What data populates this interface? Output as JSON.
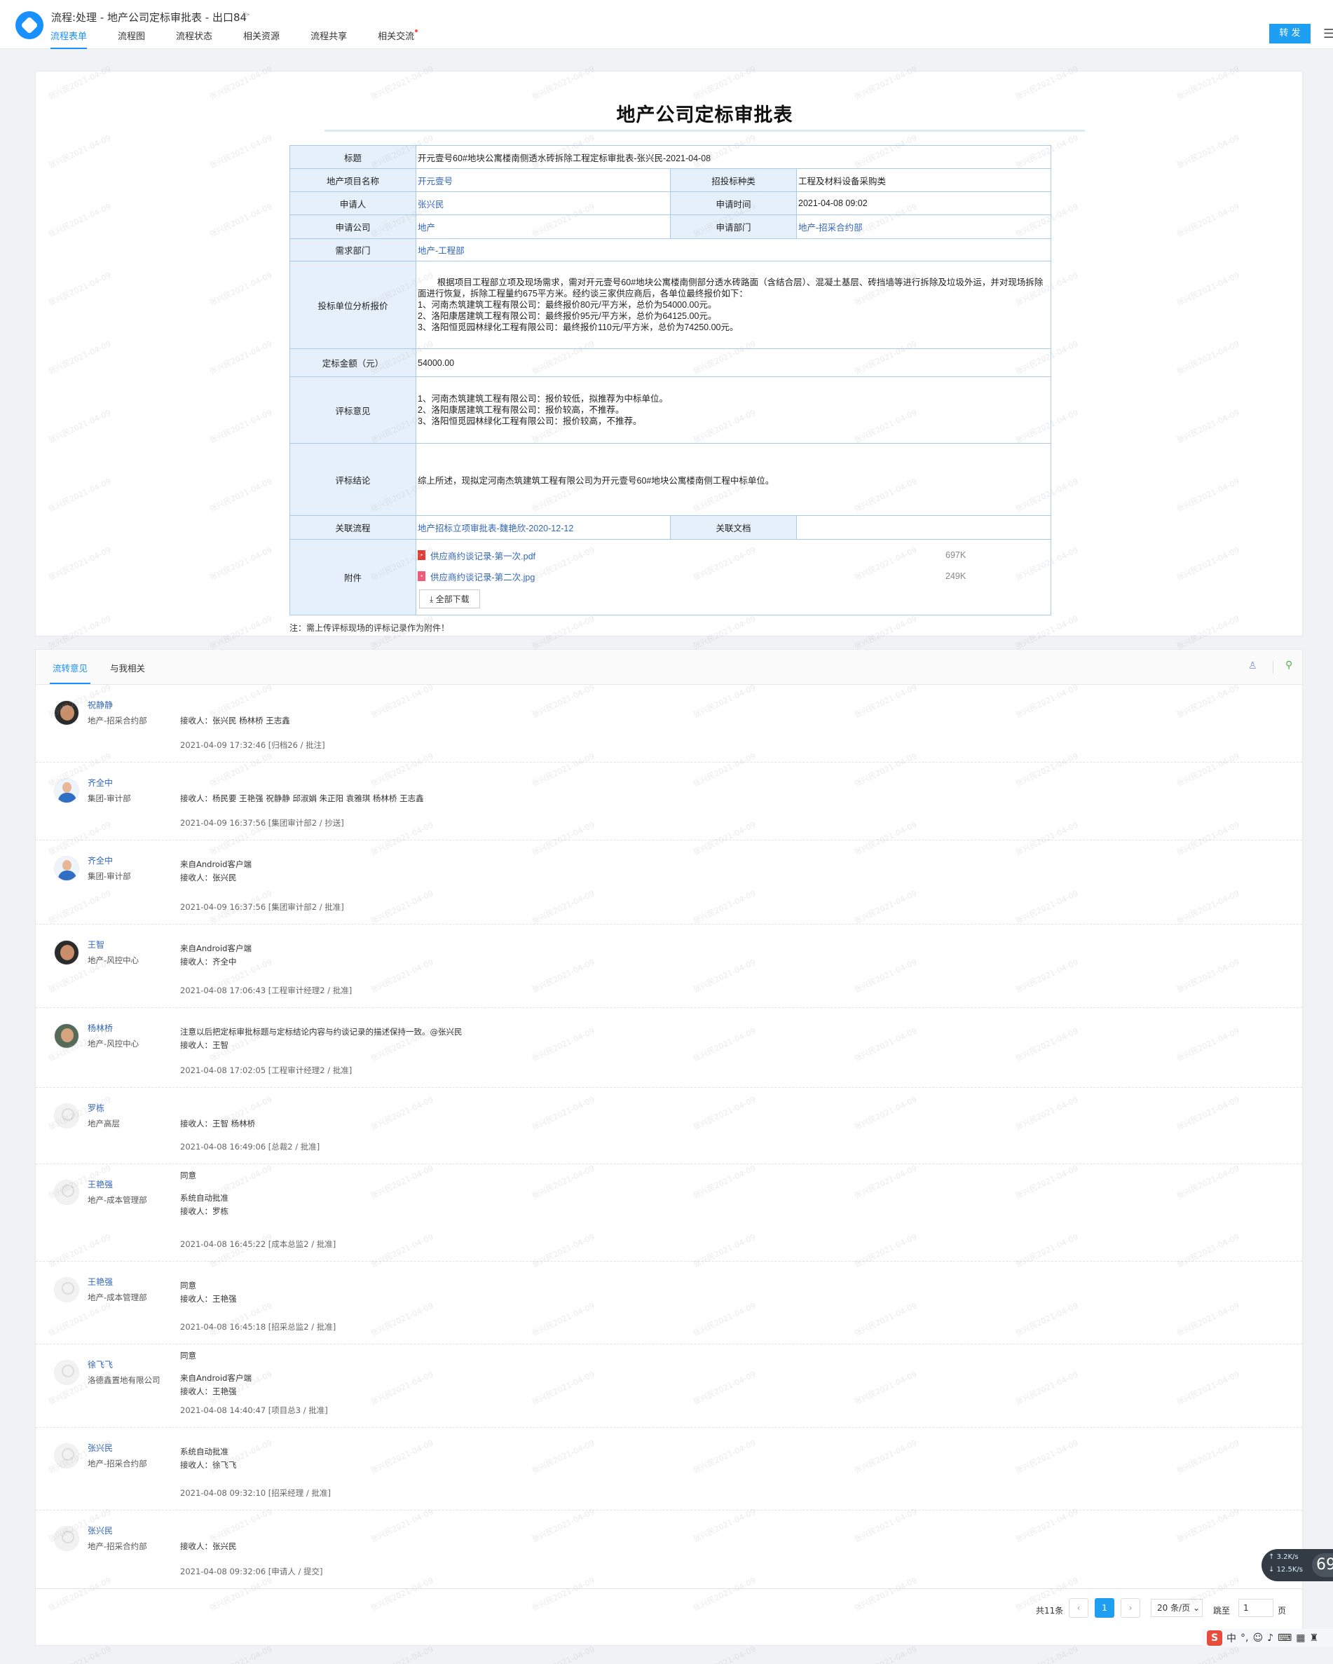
{
  "header": {
    "doc_title": "流程:处理 - 地产公司定标审批表 - 出口84",
    "tabs": [
      {
        "label": "流程表单",
        "active": true
      },
      {
        "label": "流程图"
      },
      {
        "label": "流程状态"
      },
      {
        "label": "相关资源"
      },
      {
        "label": "流程共享"
      },
      {
        "label": "相关交流",
        "badge": true
      }
    ],
    "forward_label": "转 发",
    "accent_color": "#1e9ff2"
  },
  "form": {
    "title": "地产公司定标审批表",
    "labels": {
      "title": "标题",
      "project": "地产项目名称",
      "bid_type": "招投标种类",
      "applicant": "申请人",
      "apply_time": "申请时间",
      "company": "申请公司",
      "dept": "申请部门",
      "demand_dept": "需求部门",
      "quote_analysis": "投标单位分析报价",
      "amount": "定标金额（元）",
      "opinion": "评标意见",
      "conclusion": "评标结论",
      "related_flow": "关联流程",
      "related_doc": "关联文档",
      "attachments": "附件"
    },
    "values": {
      "title": "开元壹号60#地块公寓楼南侧透水砖拆除工程定标审批表-张兴民-2021-04-08",
      "project": "开元壹号",
      "bid_type": "工程及材料设备采购类",
      "applicant": "张兴民",
      "apply_time": "2021-04-08 09:02",
      "company": "地产",
      "dept": "地产-招采合约部",
      "demand_dept": "地产-工程部",
      "quote_analysis": "        根据项目工程部立项及现场需求，需对开元壹号60#地块公寓楼南侧部分透水砖路面（含结合层）、混凝土基层、砖挡墙等进行拆除及垃圾外运，并对现场拆除面进行恢复，拆除工程量约675平方米。经约谈三家供应商后，各单位最终报价如下：\n1、河南杰筑建筑工程有限公司：最终报价80元/平方米，总价为54000.00元。\n2、洛阳康居建筑工程有限公司：最终报价95元/平方米，总价为64125.00元。\n3、洛阳恒觅园林绿化工程有限公司：最终报价110元/平方米，总价为74250.00元。",
      "amount": "54000.00",
      "opinion": "1、河南杰筑建筑工程有限公司：报价较低，拟推荐为中标单位。\n2、洛阳康居建筑工程有限公司：报价较高，不推荐。\n3、洛阳恒觅园林绿化工程有限公司：报价较高，不推荐。",
      "conclusion": "综上所述，现拟定河南杰筑建筑工程有限公司为开元壹号60#地块公寓楼南侧工程中标单位。",
      "related_flow": "地产招标立项审批表-魏艳欣-2020-12-12",
      "related_doc": ""
    },
    "attachments": [
      {
        "name": "供应商约谈记录-第一次.pdf",
        "size": "697K",
        "icon": "pdf-icon"
      },
      {
        "name": "供应商约谈记录-第二次.jpg",
        "size": "249K",
        "icon": "image-icon"
      }
    ],
    "download_all": "全部下载",
    "note": "注：需上传评标现场的评标记录作为附件！"
  },
  "comments": {
    "tabs": [
      "流转意见",
      "与我相关"
    ],
    "entries": [
      {
        "name": "祝静静",
        "dept": "地产-招采合约部",
        "avatar": "photo-dark",
        "lines": [
          "接收人：张兴民 杨林桥 王志鑫"
        ],
        "time": "2021-04-09 17:32:46",
        "node": "[归档26 / 批注]"
      },
      {
        "name": "齐全中",
        "dept": "集团-审计部",
        "avatar": "photo-person",
        "lines": [
          "接收人：杨民要 王艳强 祝静静 邱淑娟 朱正阳 袁雅琪 杨林桥 王志鑫"
        ],
        "time": "2021-04-09 16:37:56",
        "node": "[集团审计部2 / 抄送]"
      },
      {
        "name": "齐全中",
        "dept": "集团-审计部",
        "avatar": "photo-person",
        "lines": [
          "来自Android客户端",
          "接收人：张兴民"
        ],
        "time": "2021-04-09 16:37:56",
        "node": "[集团审计部2 / 批准]"
      },
      {
        "name": "王智",
        "dept": "地产-风控中心",
        "avatar": "photo-dark",
        "lines": [
          "来自Android客户端",
          "接收人：齐全中"
        ],
        "time": "2021-04-08 17:06:43",
        "node": "[工程审计经理2 / 批准]"
      },
      {
        "name": "杨林桥",
        "dept": "地产-风控中心",
        "avatar": "photo-mid",
        "lines": [
          "注意以后把定标审批标题与定标结论内容与约谈记录的描述保持一致。@张兴民",
          "接收人：王智"
        ],
        "time": "2021-04-08 17:02:05",
        "node": "[工程审计经理2 / 批准]"
      },
      {
        "name": "罗栋",
        "dept": "地产高层",
        "avatar": "blank",
        "lines": [
          "接收人：王智 杨林桥"
        ],
        "time": "2021-04-08 16:49:06",
        "node": "[总裁2 / 批准]"
      },
      {
        "name": "王艳强",
        "dept": "地产-成本管理部",
        "avatar": "blank",
        "lines": [
          "同意",
          "系统自动批准",
          "接收人：罗栋"
        ],
        "time": "2021-04-08 16:45:22",
        "node": "[成本总监2 / 批准]"
      },
      {
        "name": "王艳强",
        "dept": "地产-成本管理部",
        "avatar": "blank",
        "lines": [
          "同意",
          "接收人：王艳强"
        ],
        "time": "2021-04-08 16:45:18",
        "node": "[招采总监2 / 批准]"
      },
      {
        "name": "徐飞飞",
        "dept": "洛德鑫置地有限公司",
        "avatar": "blank",
        "lines": [
          "同意",
          "来自Android客户端",
          "接收人：王艳强"
        ],
        "time": "2021-04-08 14:40:47",
        "node": "[项目总3 / 批准]"
      },
      {
        "name": "张兴民",
        "dept": "地产-招采合约部",
        "avatar": "blank",
        "lines": [
          "系统自动批准",
          "接收人：徐飞飞"
        ],
        "time": "2021-04-08 09:32:10",
        "node": "[招采经理 / 批准]"
      },
      {
        "name": "张兴民",
        "dept": "地产-招采合约部",
        "avatar": "blank",
        "lines": [
          "接收人：张兴民"
        ],
        "time": "2021-04-08 09:32:06",
        "node": "[申请人 / 提交]"
      }
    ]
  },
  "pager": {
    "total": "共11条",
    "current": "1",
    "page_size": "20 条/页",
    "goto_label": "跳至",
    "goto_value": "1",
    "unit": "页"
  },
  "speed_widget": {
    "up": "3.2K/s",
    "down": "12.5K/s",
    "value": "69"
  },
  "ime": {
    "logo": "S",
    "lang": "中"
  },
  "watermark": "张兴民2021-04-09"
}
